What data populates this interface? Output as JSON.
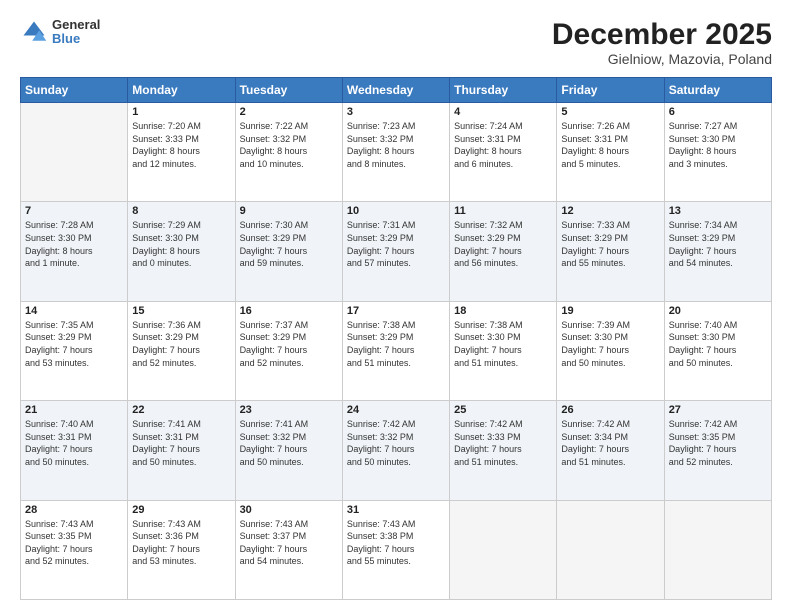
{
  "header": {
    "logo": {
      "general": "General",
      "blue": "Blue"
    },
    "title": "December 2025",
    "location": "Gielniow, Mazovia, Poland"
  },
  "days_of_week": [
    "Sunday",
    "Monday",
    "Tuesday",
    "Wednesday",
    "Thursday",
    "Friday",
    "Saturday"
  ],
  "weeks": [
    [
      {
        "day": "",
        "text": ""
      },
      {
        "day": "1",
        "text": "Sunrise: 7:20 AM\nSunset: 3:33 PM\nDaylight: 8 hours\nand 12 minutes."
      },
      {
        "day": "2",
        "text": "Sunrise: 7:22 AM\nSunset: 3:32 PM\nDaylight: 8 hours\nand 10 minutes."
      },
      {
        "day": "3",
        "text": "Sunrise: 7:23 AM\nSunset: 3:32 PM\nDaylight: 8 hours\nand 8 minutes."
      },
      {
        "day": "4",
        "text": "Sunrise: 7:24 AM\nSunset: 3:31 PM\nDaylight: 8 hours\nand 6 minutes."
      },
      {
        "day": "5",
        "text": "Sunrise: 7:26 AM\nSunset: 3:31 PM\nDaylight: 8 hours\nand 5 minutes."
      },
      {
        "day": "6",
        "text": "Sunrise: 7:27 AM\nSunset: 3:30 PM\nDaylight: 8 hours\nand 3 minutes."
      }
    ],
    [
      {
        "day": "7",
        "text": "Sunrise: 7:28 AM\nSunset: 3:30 PM\nDaylight: 8 hours\nand 1 minute."
      },
      {
        "day": "8",
        "text": "Sunrise: 7:29 AM\nSunset: 3:30 PM\nDaylight: 8 hours\nand 0 minutes."
      },
      {
        "day": "9",
        "text": "Sunrise: 7:30 AM\nSunset: 3:29 PM\nDaylight: 7 hours\nand 59 minutes."
      },
      {
        "day": "10",
        "text": "Sunrise: 7:31 AM\nSunset: 3:29 PM\nDaylight: 7 hours\nand 57 minutes."
      },
      {
        "day": "11",
        "text": "Sunrise: 7:32 AM\nSunset: 3:29 PM\nDaylight: 7 hours\nand 56 minutes."
      },
      {
        "day": "12",
        "text": "Sunrise: 7:33 AM\nSunset: 3:29 PM\nDaylight: 7 hours\nand 55 minutes."
      },
      {
        "day": "13",
        "text": "Sunrise: 7:34 AM\nSunset: 3:29 PM\nDaylight: 7 hours\nand 54 minutes."
      }
    ],
    [
      {
        "day": "14",
        "text": "Sunrise: 7:35 AM\nSunset: 3:29 PM\nDaylight: 7 hours\nand 53 minutes."
      },
      {
        "day": "15",
        "text": "Sunrise: 7:36 AM\nSunset: 3:29 PM\nDaylight: 7 hours\nand 52 minutes."
      },
      {
        "day": "16",
        "text": "Sunrise: 7:37 AM\nSunset: 3:29 PM\nDaylight: 7 hours\nand 52 minutes."
      },
      {
        "day": "17",
        "text": "Sunrise: 7:38 AM\nSunset: 3:29 PM\nDaylight: 7 hours\nand 51 minutes."
      },
      {
        "day": "18",
        "text": "Sunrise: 7:38 AM\nSunset: 3:30 PM\nDaylight: 7 hours\nand 51 minutes."
      },
      {
        "day": "19",
        "text": "Sunrise: 7:39 AM\nSunset: 3:30 PM\nDaylight: 7 hours\nand 50 minutes."
      },
      {
        "day": "20",
        "text": "Sunrise: 7:40 AM\nSunset: 3:30 PM\nDaylight: 7 hours\nand 50 minutes."
      }
    ],
    [
      {
        "day": "21",
        "text": "Sunrise: 7:40 AM\nSunset: 3:31 PM\nDaylight: 7 hours\nand 50 minutes."
      },
      {
        "day": "22",
        "text": "Sunrise: 7:41 AM\nSunset: 3:31 PM\nDaylight: 7 hours\nand 50 minutes."
      },
      {
        "day": "23",
        "text": "Sunrise: 7:41 AM\nSunset: 3:32 PM\nDaylight: 7 hours\nand 50 minutes."
      },
      {
        "day": "24",
        "text": "Sunrise: 7:42 AM\nSunset: 3:32 PM\nDaylight: 7 hours\nand 50 minutes."
      },
      {
        "day": "25",
        "text": "Sunrise: 7:42 AM\nSunset: 3:33 PM\nDaylight: 7 hours\nand 51 minutes."
      },
      {
        "day": "26",
        "text": "Sunrise: 7:42 AM\nSunset: 3:34 PM\nDaylight: 7 hours\nand 51 minutes."
      },
      {
        "day": "27",
        "text": "Sunrise: 7:42 AM\nSunset: 3:35 PM\nDaylight: 7 hours\nand 52 minutes."
      }
    ],
    [
      {
        "day": "28",
        "text": "Sunrise: 7:43 AM\nSunset: 3:35 PM\nDaylight: 7 hours\nand 52 minutes."
      },
      {
        "day": "29",
        "text": "Sunrise: 7:43 AM\nSunset: 3:36 PM\nDaylight: 7 hours\nand 53 minutes."
      },
      {
        "day": "30",
        "text": "Sunrise: 7:43 AM\nSunset: 3:37 PM\nDaylight: 7 hours\nand 54 minutes."
      },
      {
        "day": "31",
        "text": "Sunrise: 7:43 AM\nSunset: 3:38 PM\nDaylight: 7 hours\nand 55 minutes."
      },
      {
        "day": "",
        "text": ""
      },
      {
        "day": "",
        "text": ""
      },
      {
        "day": "",
        "text": ""
      }
    ]
  ]
}
